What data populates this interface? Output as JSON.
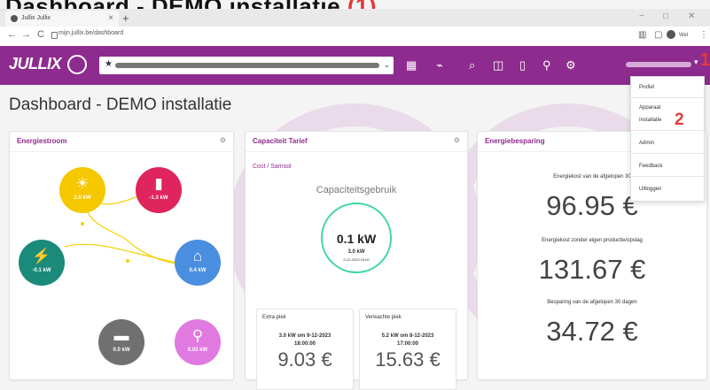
{
  "page_heading": {
    "text": "Dashboard - DEMO installatie",
    "step": "(1)"
  },
  "browser": {
    "tab_title": "Jullix Jullix",
    "tab_close": "×",
    "new_tab": "+",
    "url": "mijn.jullix.be/dashboard",
    "win_min": "−",
    "win_max": "□",
    "win_close": "✕",
    "nav_back": "←",
    "nav_forward": "→",
    "nav_reload": "C",
    "profile_label": "Wel"
  },
  "appbar": {
    "logo": "JULLIX",
    "select_star": "★",
    "select_chevron": "⌄",
    "icons": [
      "dashboard-icon",
      "chart-icon",
      "search-icon",
      "meter-icon",
      "battery-icon",
      "plug-icon",
      "gear-icon"
    ],
    "user_caret": "▾",
    "annotation_1": "1"
  },
  "page_title": "Dashboard - DEMO installatie",
  "energiestroom": {
    "title": "Energiestroom",
    "menu": "⚙",
    "nodes": {
      "solar": {
        "icon": "solar-panel-icon",
        "glyph": "☀",
        "value": "2.0 kW",
        "color": "#f5c800"
      },
      "battery": {
        "icon": "battery-icon",
        "glyph": "▮",
        "value": "-1.3 kW",
        "color": "#e0245e"
      },
      "grid": {
        "icon": "grid-tower-icon",
        "glyph": "⚡",
        "value": "-0.1 kW",
        "color": "#1a8a7a"
      },
      "home": {
        "icon": "home-icon",
        "glyph": "⌂",
        "value": "0.4 kW",
        "color": "#4a8ee0"
      },
      "car": {
        "icon": "car-icon",
        "glyph": "🚗",
        "value": "0.0 kW",
        "color": "#707070"
      },
      "plug": {
        "icon": "plug-icon",
        "glyph": "⚲",
        "value": "0.02 kW",
        "color": "#e07ae0"
      }
    }
  },
  "capaciteit": {
    "title": "Capaciteit Tarief",
    "menu": "⚙",
    "links": "Cost  /  Samsol",
    "gauge_title": "Capaciteitsgebruik",
    "gauge_value": "0.1 kW",
    "gauge_sub": "3.0 kW",
    "gauge_date": "9-12-2023 18:00",
    "extra_piek": {
      "title": "Extra piek",
      "line1": "3.0 kW om 9-12-2023",
      "line2": "18:00:00",
      "value": "9.03 €"
    },
    "verwacht_piek": {
      "title": "Verwachte piek",
      "line1": "5.2 kW om 8-12-2023",
      "line2": "17:00:00",
      "value": "15.63 €"
    }
  },
  "besparing": {
    "title": "Energiebesparing",
    "items": [
      {
        "label": "Energiekost van de afgelopen 30",
        "value": "96.95 €"
      },
      {
        "label": "Energiekost zonder eigen productie/opslag",
        "value": "131.67 €"
      },
      {
        "label": "Besparing van de afgelopen 30 dagen",
        "value": "34.72 €"
      }
    ]
  },
  "dropdown": {
    "items": [
      "Profiel",
      "Apparaat",
      "Installatie",
      "Admin",
      "Feedback",
      "Uitloggen"
    ],
    "annotation_2": "2"
  }
}
